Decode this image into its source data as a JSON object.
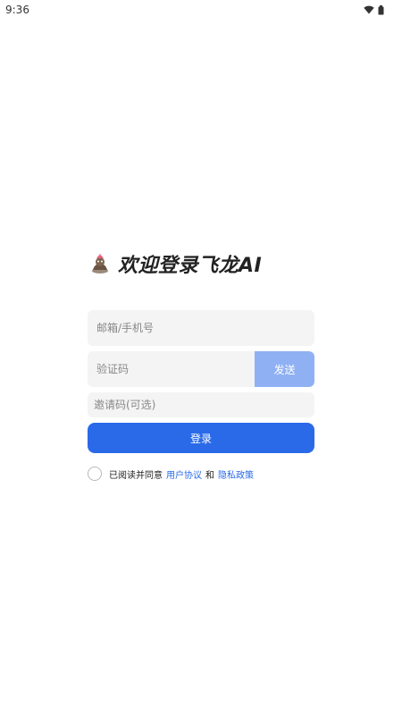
{
  "status_bar": {
    "time": "9:36",
    "icons": [
      "wifi-icon",
      "battery-icon"
    ]
  },
  "login": {
    "title": "欢迎登录飞龙AI",
    "logo_icon": "dragon-mascot-icon",
    "account_placeholder": "邮箱/手机号",
    "code_placeholder": "验证码",
    "send_label": "发送",
    "invite_placeholder": "邀请码(可选)",
    "login_label": "登录"
  },
  "agreement": {
    "prefix": "已阅读并同意",
    "user_agreement": "用户协议",
    "conjunction": "和",
    "privacy_policy": "隐私政策"
  },
  "colors": {
    "primary": "#2a6ae9",
    "send_disabled": "#8fb1f4",
    "field_bg": "#f4f4f5",
    "link": "#2a6ae9"
  }
}
